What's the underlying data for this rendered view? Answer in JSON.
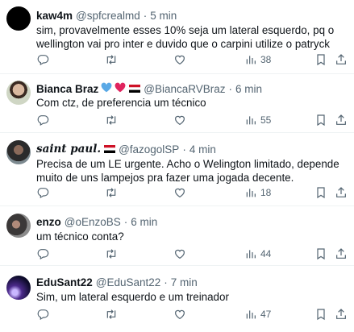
{
  "tweets": [
    {
      "name": "kaw4m",
      "handle": "@spfcrealmd",
      "dot": "·",
      "time": "5 min",
      "text": "sim, provavelmente esses 10% seja um lateral esquerdo, pq o wellington vai pro inter e duvido que o carpini utilize o patryck",
      "views": "38"
    },
    {
      "name": "Bianca Braz",
      "handle": "@BiancaRVBraz",
      "dot": "·",
      "time": "6 min",
      "text": "Com ctz, de preferencia um técnico",
      "views": "55"
    },
    {
      "name": "saint paul.",
      "handle": "@fazogolSP",
      "dot": "·",
      "time": "4 min",
      "text": "Precisa de um LE urgente. Acho o Welington limitado, depende muito de uns lampejos pra fazer uma jogada decente.",
      "views": "18"
    },
    {
      "name": "enzo",
      "handle": "@oEnzoBS",
      "dot": "·",
      "time": "6 min",
      "text": "um técnico conta?",
      "views": "44"
    },
    {
      "name": "EduSant22",
      "handle": "@EduSant22",
      "dot": "·",
      "time": "7 min",
      "text": "Sim, um lateral esquerdo e um treinador",
      "views": "47"
    }
  ],
  "icons": {
    "reply": "reply-icon",
    "retweet": "retweet-icon",
    "like": "heart-icon",
    "views": "views-icon",
    "bookmark": "bookmark-icon",
    "share": "share-icon"
  },
  "colors": {
    "text": "#0f1419",
    "secondary": "#536471",
    "divider": "#eff3f4",
    "heart_blue": "#5aa9e6",
    "heart_red": "#e0245e"
  }
}
